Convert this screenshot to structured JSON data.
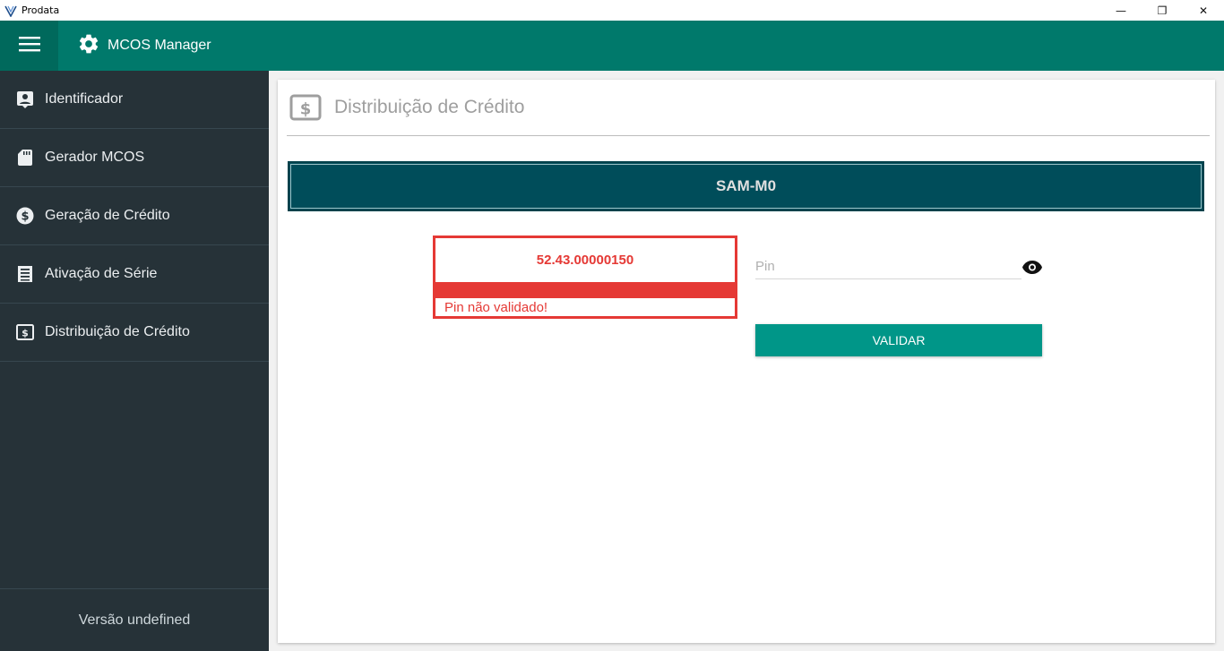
{
  "window": {
    "title": "Prodata",
    "controls": {
      "minimize": "—",
      "restore": "❐",
      "close": "✕"
    }
  },
  "appbar": {
    "app_name": "MCOS Manager"
  },
  "sidebar": {
    "items": [
      {
        "label": "Identificador",
        "icon": "badge-icon"
      },
      {
        "label": "Gerador MCOS",
        "icon": "sd-card-icon"
      },
      {
        "label": "Geração de Crédito",
        "icon": "dollar-circle-icon"
      },
      {
        "label": "Ativação de Série",
        "icon": "list-icon"
      },
      {
        "label": "Distribuição de Crédito",
        "icon": "dollar-box-icon"
      }
    ],
    "footer": "Versão undefined"
  },
  "main": {
    "title": "Distribuição de Crédito",
    "sam_label": "SAM-M0",
    "serial_value": "52.43.00000150",
    "serial_error": "Pin não validado!",
    "pin_placeholder": "Pin",
    "validate_button": "VALIDAR"
  },
  "colors": {
    "appbar": "#00796b",
    "sidebar": "#263238",
    "sam_bar": "#004d5a",
    "error": "#e53935",
    "button": "#009688"
  }
}
